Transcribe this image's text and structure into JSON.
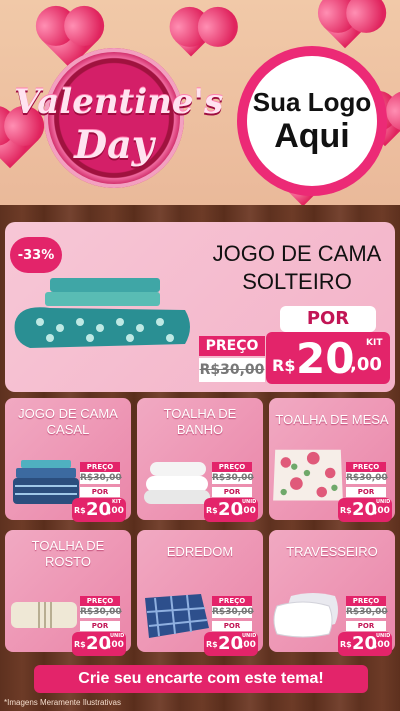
{
  "header": {
    "title_line1": "Valentine's",
    "title_line2": "Day",
    "logo_line1": "Sua Logo",
    "logo_line2": "Aqui"
  },
  "hero": {
    "discount": "-33%",
    "title_line1": "JOGO DE CAMA",
    "title_line2": "SOLTEIRO",
    "price_label": "PREÇO",
    "old_price": "R$30,00",
    "por_label": "POR",
    "kit_label": "KIT",
    "new_price_currency": "R$",
    "new_price_int": "20",
    "new_price_dec": ",00"
  },
  "products": [
    {
      "title_line1": "JOGO DE CAMA",
      "title_line2": "CASAL",
      "price_label": "PREÇO",
      "old_price": "R$30,00",
      "por_label": "POR",
      "unit": "KIT",
      "currency": "R$",
      "price_int": "20",
      "price_dec": ",00"
    },
    {
      "title_line1": "TOALHA DE",
      "title_line2": "BANHO",
      "price_label": "PREÇO",
      "old_price": "R$30,00",
      "por_label": "POR",
      "unit": "UNID",
      "currency": "R$",
      "price_int": "20",
      "price_dec": ",00"
    },
    {
      "title_line1": "TOALHA DE MESA",
      "title_line2": "",
      "price_label": "PREÇO",
      "old_price": "R$30,00",
      "por_label": "POR",
      "unit": "UNID",
      "currency": "R$",
      "price_int": "20",
      "price_dec": ",00"
    },
    {
      "title_line1": "TOALHA DE",
      "title_line2": "ROSTO",
      "price_label": "PREÇO",
      "old_price": "R$30,00",
      "por_label": "POR",
      "unit": "UNID",
      "currency": "R$",
      "price_int": "20",
      "price_dec": ",00"
    },
    {
      "title_line1": "EDREDOM",
      "title_line2": "",
      "price_label": "PREÇO",
      "old_price": "R$30,00",
      "por_label": "POR",
      "unit": "UNID",
      "currency": "R$",
      "price_int": "20",
      "price_dec": ",00"
    },
    {
      "title_line1": "TRAVESSEIRO",
      "title_line2": "",
      "price_label": "PREÇO",
      "old_price": "R$30,00",
      "por_label": "POR",
      "unit": "UNID",
      "currency": "R$",
      "price_int": "20",
      "price_dec": ",00"
    }
  ],
  "footer": {
    "cta": "Crie seu encarte com este tema!",
    "disclaimer": "*Imagens Meramente Ilustrativas"
  },
  "colors": {
    "accent": "#e3246a",
    "card_pink": "#f1a9c2",
    "wood": "#6b3a25"
  }
}
